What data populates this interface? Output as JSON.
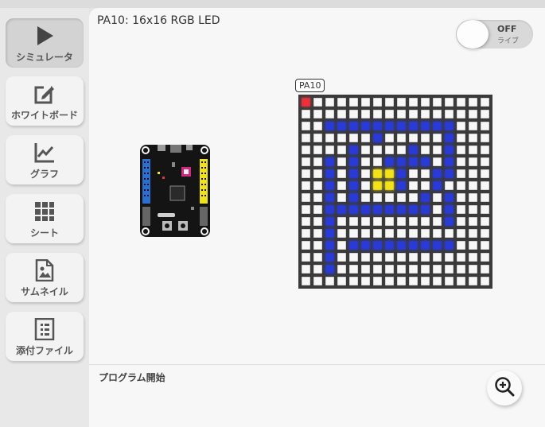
{
  "header": {
    "title": "PA10: 16x16 RGB LED"
  },
  "live_toggle": {
    "state": "OFF",
    "label": "ライブ"
  },
  "sidebar": {
    "items": [
      {
        "label": "シミュレータ",
        "icon": "play-icon",
        "active": true
      },
      {
        "label": "ホワイトボード",
        "icon": "whiteboard-edit-icon",
        "active": false
      },
      {
        "label": "グラフ",
        "icon": "line-chart-icon",
        "active": false
      },
      {
        "label": "シート",
        "icon": "grid-sheet-icon",
        "active": false
      },
      {
        "label": "サムネイル",
        "icon": "image-file-icon",
        "active": false
      },
      {
        "label": "添付ファイル",
        "icon": "list-file-icon",
        "active": false
      }
    ]
  },
  "simulator": {
    "pin_label": "PA10",
    "led_rows": [
      "R...............",
      "................",
      "..BBBBBBBBBBB...",
      "......B.....B...",
      "....B....B..B...",
      "..B.B..BBBB.B...",
      "..B.B.YYB..BB...",
      "..B.B.YYB..B....",
      "..B.B.....B.B...",
      "..BBBBBBBBB.B...",
      "..B.........B...",
      "..B.............",
      "..B.BBBBBBBBB...",
      "..B.............",
      "..B.............",
      "................"
    ],
    "colors": {
      "R": "#e8323c",
      "B": "#2a3ad6",
      "Y": "#f2e21a",
      "off": "#f7f7f7",
      "frame": "#3a3a3a"
    },
    "board_icon": "microcontroller-board-icon"
  },
  "status": {
    "text": "プログラム開始"
  },
  "zoom_button": {
    "icon": "zoom-in-icon"
  }
}
